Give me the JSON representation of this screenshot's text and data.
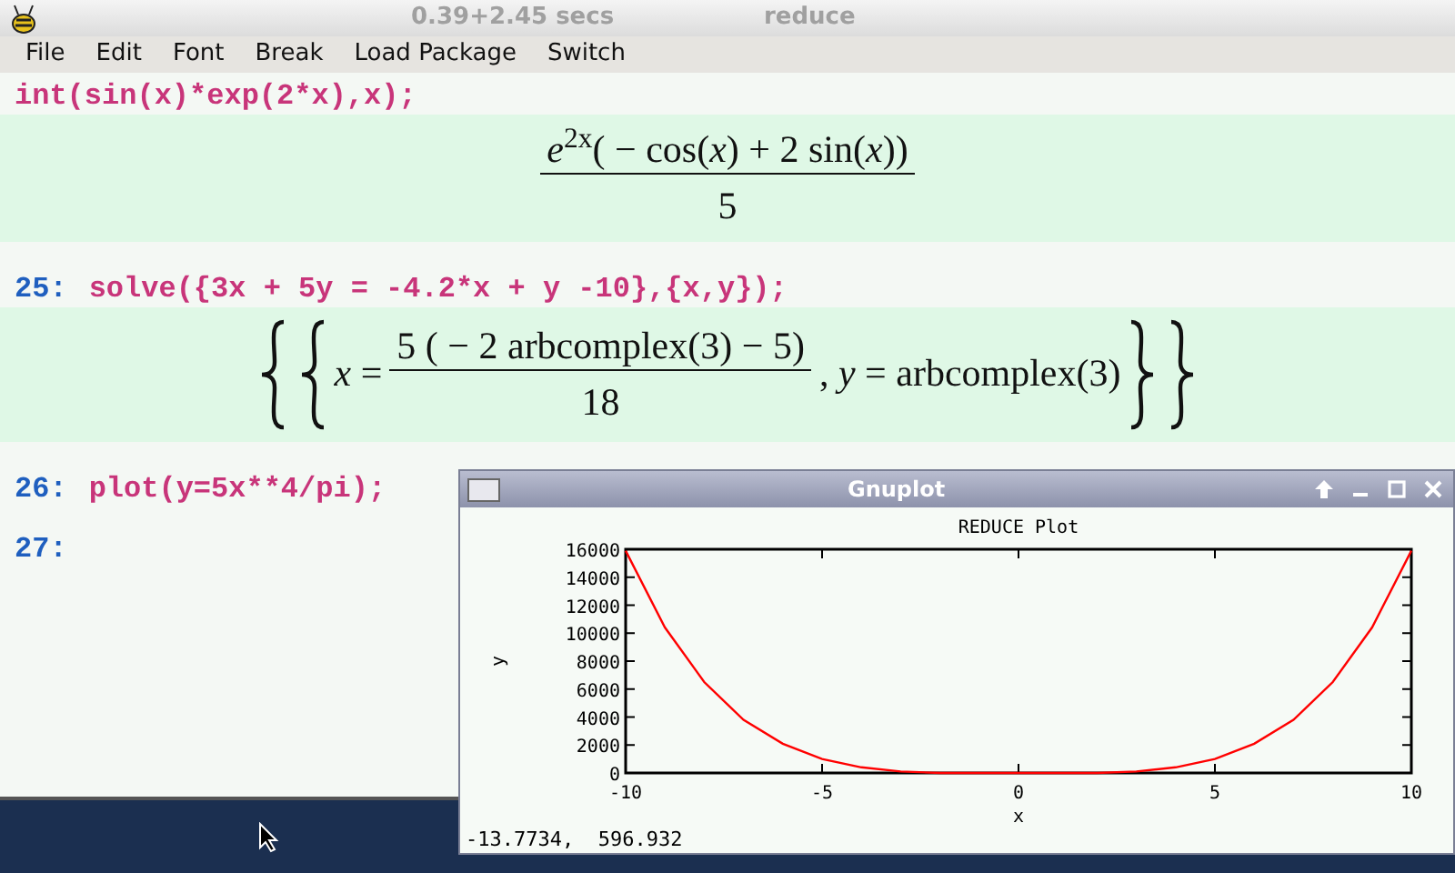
{
  "window": {
    "timing": "0.39+2.45 secs",
    "title": "reduce"
  },
  "menu": [
    "File",
    "Edit",
    "Font",
    "Break",
    "Load Package",
    "Switch"
  ],
  "worksheet": [
    {
      "kind": "input",
      "code": "int(sin(x)*exp(2*x),x);"
    },
    {
      "kind": "output",
      "numerator": "*e*$^{2x}$( − cos(*x*) + 2 sin(*x*))",
      "denominator": "5",
      "braces": false
    },
    {
      "kind": "input",
      "prompt": "25:",
      "code": "solve({3x + 5y = -4.2*x + y -10},{x,y});"
    },
    {
      "kind": "output",
      "left": "*x* =",
      "numerator": "5 ( − 2 arbcomplex(3) − 5)",
      "denominator": "18",
      "right": ",  *y* = arbcomplex(3)",
      "braces": true
    },
    {
      "kind": "input",
      "prompt": "26:",
      "code": "plot(y=5x**4/pi);"
    },
    {
      "kind": "input",
      "prompt": "27:"
    }
  ],
  "gnuplot": {
    "title": "Gnuplot",
    "chart_data": {
      "type": "line",
      "title": "REDUCE Plot",
      "xlabel": "x",
      "ylabel": "y",
      "x": [
        -10,
        -9,
        -8,
        -7,
        -6,
        -5,
        -4,
        -3,
        -2,
        -1,
        0,
        1,
        2,
        3,
        4,
        5,
        6,
        7,
        8,
        9,
        10
      ],
      "series": [
        {
          "color": "#ff0000",
          "values": [
            15900,
            10400,
            6500,
            3800,
            2100,
            1000,
            400,
            100,
            0,
            0,
            0,
            0,
            0,
            100,
            400,
            1000,
            2100,
            3800,
            6500,
            10400,
            15900
          ]
        }
      ],
      "xlim": [
        -10,
        10
      ],
      "ylim": [
        0,
        16000
      ],
      "xticks": [
        -10,
        -5,
        0,
        5,
        10
      ],
      "yticks": [
        0,
        2000,
        4000,
        6000,
        8000,
        10000,
        12000,
        14000,
        16000
      ]
    },
    "status": "-13.7734,  596.932"
  }
}
